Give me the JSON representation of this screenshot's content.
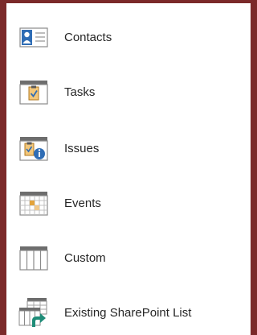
{
  "list_types": {
    "items": [
      {
        "label": "Contacts",
        "icon": "contacts-list-icon"
      },
      {
        "label": "Tasks",
        "icon": "tasks-list-icon"
      },
      {
        "label": "Issues",
        "icon": "issues-list-icon"
      },
      {
        "label": "Events",
        "icon": "events-calendar-icon"
      },
      {
        "label": "Custom",
        "icon": "custom-list-icon"
      },
      {
        "label": "Existing SharePoint List",
        "icon": "sharepoint-list-icon"
      }
    ]
  },
  "colors": {
    "frame": "#7b2a2a",
    "panel": "#ffffff",
    "accent_blue": "#2f6db5",
    "accent_orange": "#e3a33a",
    "icon_gray": "#8a8a8a",
    "sharepoint_teal": "#1f8c78"
  }
}
